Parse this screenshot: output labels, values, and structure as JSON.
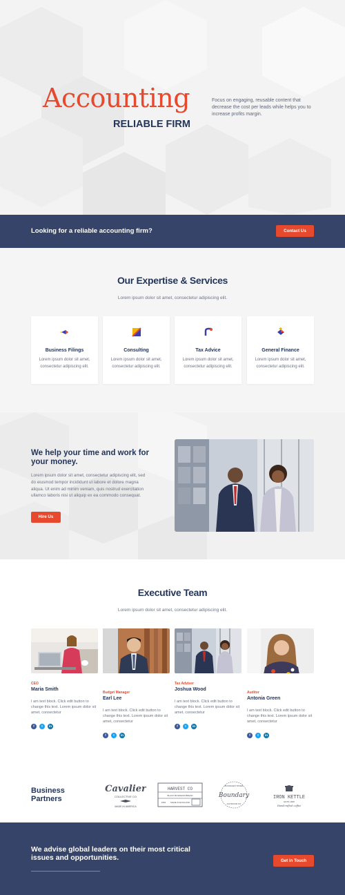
{
  "hero": {
    "title": "Accounting",
    "subtitle": "RELIABLE FIRM",
    "description": "Focus on engaging, reusable content that decrease the cost per leads while helps you to increase profits margin."
  },
  "banner": {
    "text": "Looking for a reliable accounting firm?",
    "button": "Contact Us"
  },
  "expertise": {
    "title": "Our Expertise & Services",
    "subtitle": "Lorem ipsum dolor sit amet, consectetur adipiscing elit.",
    "cards": [
      {
        "title": "Business Filings",
        "text": "Lorem ipsum dolor sit amet, consectetur adipiscing elit."
      },
      {
        "title": "Consulting",
        "text": "Lorem ipsum dolor sit amet, consectetur adipiscing elit."
      },
      {
        "title": "Tax Advice",
        "text": "Lorem ipsum dolor sit amet, consectetur adipiscing elit."
      },
      {
        "title": "General Finance",
        "text": "Lorem ipsum dolor sit amet, consectetur adipiscing elit."
      }
    ]
  },
  "help": {
    "title": "We help your time and work for your money.",
    "body": "Lorem ipsum dolor sit amet, consectetur adipiscing elit, sed do eiusmod tempor incididunt ut labore et dolore magna aliqua. Ut enim ad minim veniam, quis nostrud exercitation ullamco laboris nisi ut aliquip ex ea commodo consequat.",
    "button": "Hire Us"
  },
  "team": {
    "title": "Executive Team",
    "subtitle": "Lorem ipsum dolor sit amet, consectetur adipiscing elit.",
    "members": [
      {
        "role": "CEO",
        "name": "Maria Smith",
        "text": "I am text block. Click edit button to change this text. Lorem ipsum dolor sit amet, consectetur"
      },
      {
        "role": "Budget Manager",
        "name": "Earl Lee",
        "text": "I am text block. Click edit button to change this text. Lorem ipsum dolor sit amet, consectetur"
      },
      {
        "role": "Tax Adviser",
        "name": "Joshua Wood",
        "text": "I am text block. Click edit button to change this text. Lorem ipsum dolor sit amet, consectetur"
      },
      {
        "role": "Auditor",
        "name": "Antonia Green",
        "text": "I am text block. Click edit button to change this text. Lorem ipsum dolor sit amet, consectetur"
      }
    ]
  },
  "partners": {
    "title": "Business Partners",
    "logos": {
      "cavalier": {
        "name": "Cavalier",
        "line1": "COLLECTIVE CO",
        "line2": "MADE IN AMERICA"
      },
      "harvest": {
        "name": "HARVEST CO",
        "line1": "BLACK BUSINESS BREAD",
        "line2": "MADE IN ENGLAND",
        "year": "1954"
      },
      "boundary": {
        "name": "Boundary",
        "top": "BOUNDARY RIVER",
        "bottom": "OUTDOOR CO"
      },
      "kettle": {
        "name": "IRON KETTLE",
        "line1": "ESTD 1908",
        "line2": "Handcrafted coffee"
      }
    }
  },
  "cta": {
    "title": "We advise global leaders on their most critical issues and opportunities.",
    "button": "Get in Touch"
  },
  "colors": {
    "accent": "#e6492d",
    "navy": "#354468",
    "heading": "#233559"
  },
  "icons": {
    "facebook": "f",
    "twitter": "t",
    "linkedin": "in"
  }
}
